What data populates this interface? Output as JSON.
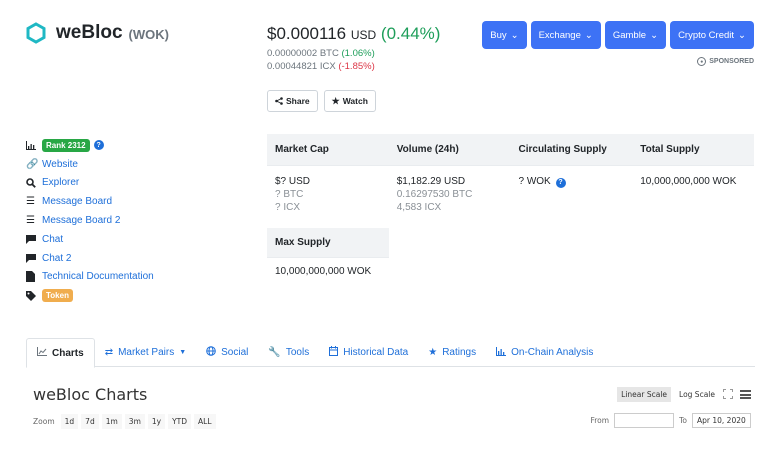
{
  "coin": {
    "name": "weBloc",
    "symbol": "(WOK)"
  },
  "price": {
    "usd_value": "$0.000116",
    "usd_unit": "USD",
    "usd_change": "(0.44%)",
    "btc_value": "0.00000002 BTC",
    "btc_change": "(1.06%)",
    "icx_value": "0.00044821 ICX",
    "icx_change": "(-1.85%)"
  },
  "actions": {
    "share_label": "Share",
    "watch_label": "Watch"
  },
  "top_buttons": [
    {
      "label": "Buy"
    },
    {
      "label": "Exchange"
    },
    {
      "label": "Gamble"
    },
    {
      "label": "Crypto Credit"
    }
  ],
  "sponsored_label": "SPONSORED",
  "rank_label": "Rank 2312",
  "links": {
    "website": "Website",
    "explorer": "Explorer",
    "message_board": "Message Board",
    "message_board_2": "Message Board 2",
    "chat": "Chat",
    "chat_2": "Chat 2",
    "tech_doc": "Technical Documentation"
  },
  "token_badge": "Token",
  "stats": {
    "headers": [
      "Market Cap",
      "Volume (24h)",
      "Circulating Supply",
      "Total Supply"
    ],
    "market_cap": [
      "$? USD",
      "? BTC",
      "? ICX"
    ],
    "volume": [
      "$1,182.29 USD",
      "0.16297530 BTC",
      "4,583 ICX"
    ],
    "circulating": "? WOK",
    "total_supply": "10,000,000,000 WOK",
    "max_supply_header": "Max Supply",
    "max_supply": "10,000,000,000 WOK"
  },
  "tabs": [
    {
      "label": "Charts"
    },
    {
      "label": "Market Pairs"
    },
    {
      "label": "Social"
    },
    {
      "label": "Tools"
    },
    {
      "label": "Historical Data"
    },
    {
      "label": "Ratings"
    },
    {
      "label": "On-Chain Analysis"
    }
  ],
  "chart_panel": {
    "title": "weBloc Charts",
    "linear_scale": "Linear Scale",
    "log_scale": "Log Scale",
    "zoom_label": "Zoom",
    "zoom_options": [
      "1d",
      "7d",
      "1m",
      "3m",
      "1y",
      "YTD",
      "ALL"
    ],
    "from_label": "From",
    "from_value": "",
    "to_label": "To",
    "to_value": "Apr 10, 2020"
  },
  "colors": {
    "accent_blue": "#3d72f5",
    "positive": "#1e9e5a",
    "negative": "#dc3545",
    "logo": "#1fb8c4"
  }
}
